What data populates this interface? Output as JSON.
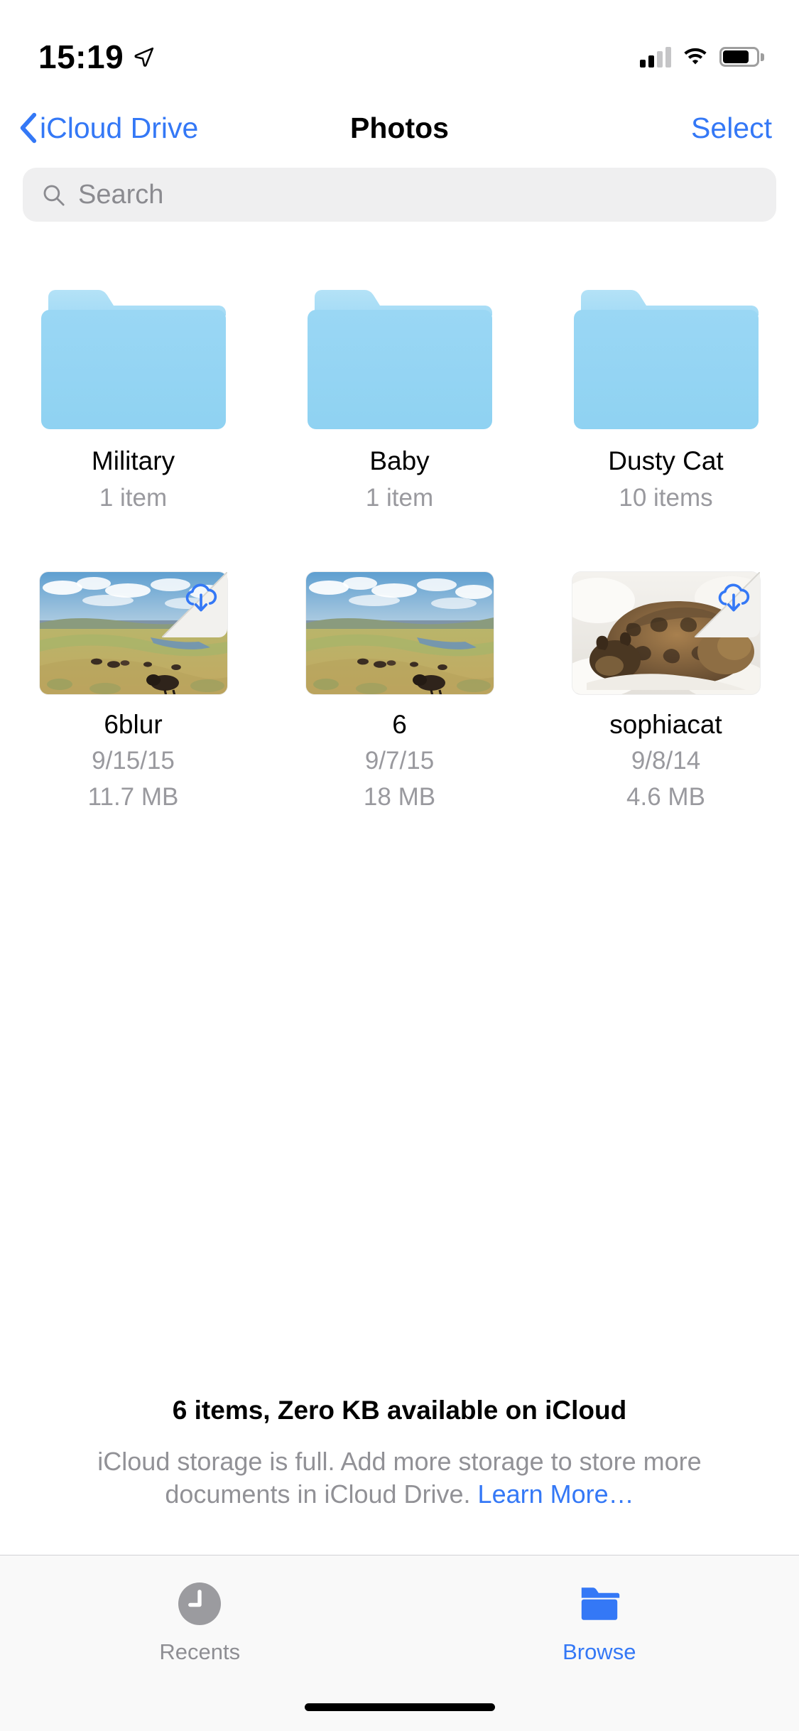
{
  "status_bar": {
    "time": "15:19",
    "location_icon": "location-arrow-icon",
    "signal_icon": "cellular-signal-icon",
    "signal_bars_filled": 2,
    "signal_bars_total": 4,
    "wifi_icon": "wifi-icon",
    "battery_icon": "battery-icon",
    "battery_level_percent": 72
  },
  "nav": {
    "back_label": "iCloud Drive",
    "back_icon": "chevron-left-icon",
    "title": "Photos",
    "select_label": "Select"
  },
  "search": {
    "placeholder": "Search",
    "value": "",
    "icon": "search-icon"
  },
  "items": [
    {
      "name": "Military",
      "sub1": "1 item",
      "sub2": "",
      "kind": "folder",
      "icon": "folder-icon",
      "badge": ""
    },
    {
      "name": "Baby",
      "sub1": "1 item",
      "sub2": "",
      "kind": "folder",
      "icon": "folder-icon",
      "badge": ""
    },
    {
      "name": "Dusty Cat",
      "sub1": "10 items",
      "sub2": "",
      "kind": "folder",
      "icon": "folder-icon",
      "badge": ""
    },
    {
      "name": "6blur",
      "sub1": "9/15/15",
      "sub2": "11.7 MB",
      "kind": "photo",
      "thumbnail": "prairie-landscape-with-bison",
      "badge": "icloud-download-icon",
      "not_downloaded": true
    },
    {
      "name": "6",
      "sub1": "9/7/15",
      "sub2": "18 MB",
      "kind": "photo",
      "thumbnail": "prairie-landscape-with-bison",
      "badge": "",
      "not_downloaded": false
    },
    {
      "name": "sophiacat",
      "sub1": "9/8/14",
      "sub2": "4.6 MB",
      "kind": "photo",
      "thumbnail": "tabby-cat-sleeping-on-white-blanket",
      "badge": "icloud-download-icon",
      "not_downloaded": true
    }
  ],
  "footer": {
    "count_text": "6 items, Zero KB available on iCloud",
    "message_line1": "iCloud storage is full. Add more storage to store more",
    "message_line2": "documents in iCloud Drive. ",
    "learn_more": "Learn More…"
  },
  "tabs": [
    {
      "label": "Recents",
      "icon": "clock-icon",
      "active": false
    },
    {
      "label": "Browse",
      "icon": "folder-icon",
      "active": true
    }
  ],
  "colors": {
    "accent": "#3478f6",
    "folder_blue": "#9ed8f5",
    "secondary_text": "#99999e",
    "search_bg": "#efeff0",
    "tabbar_bg": "#f9f9f9"
  }
}
